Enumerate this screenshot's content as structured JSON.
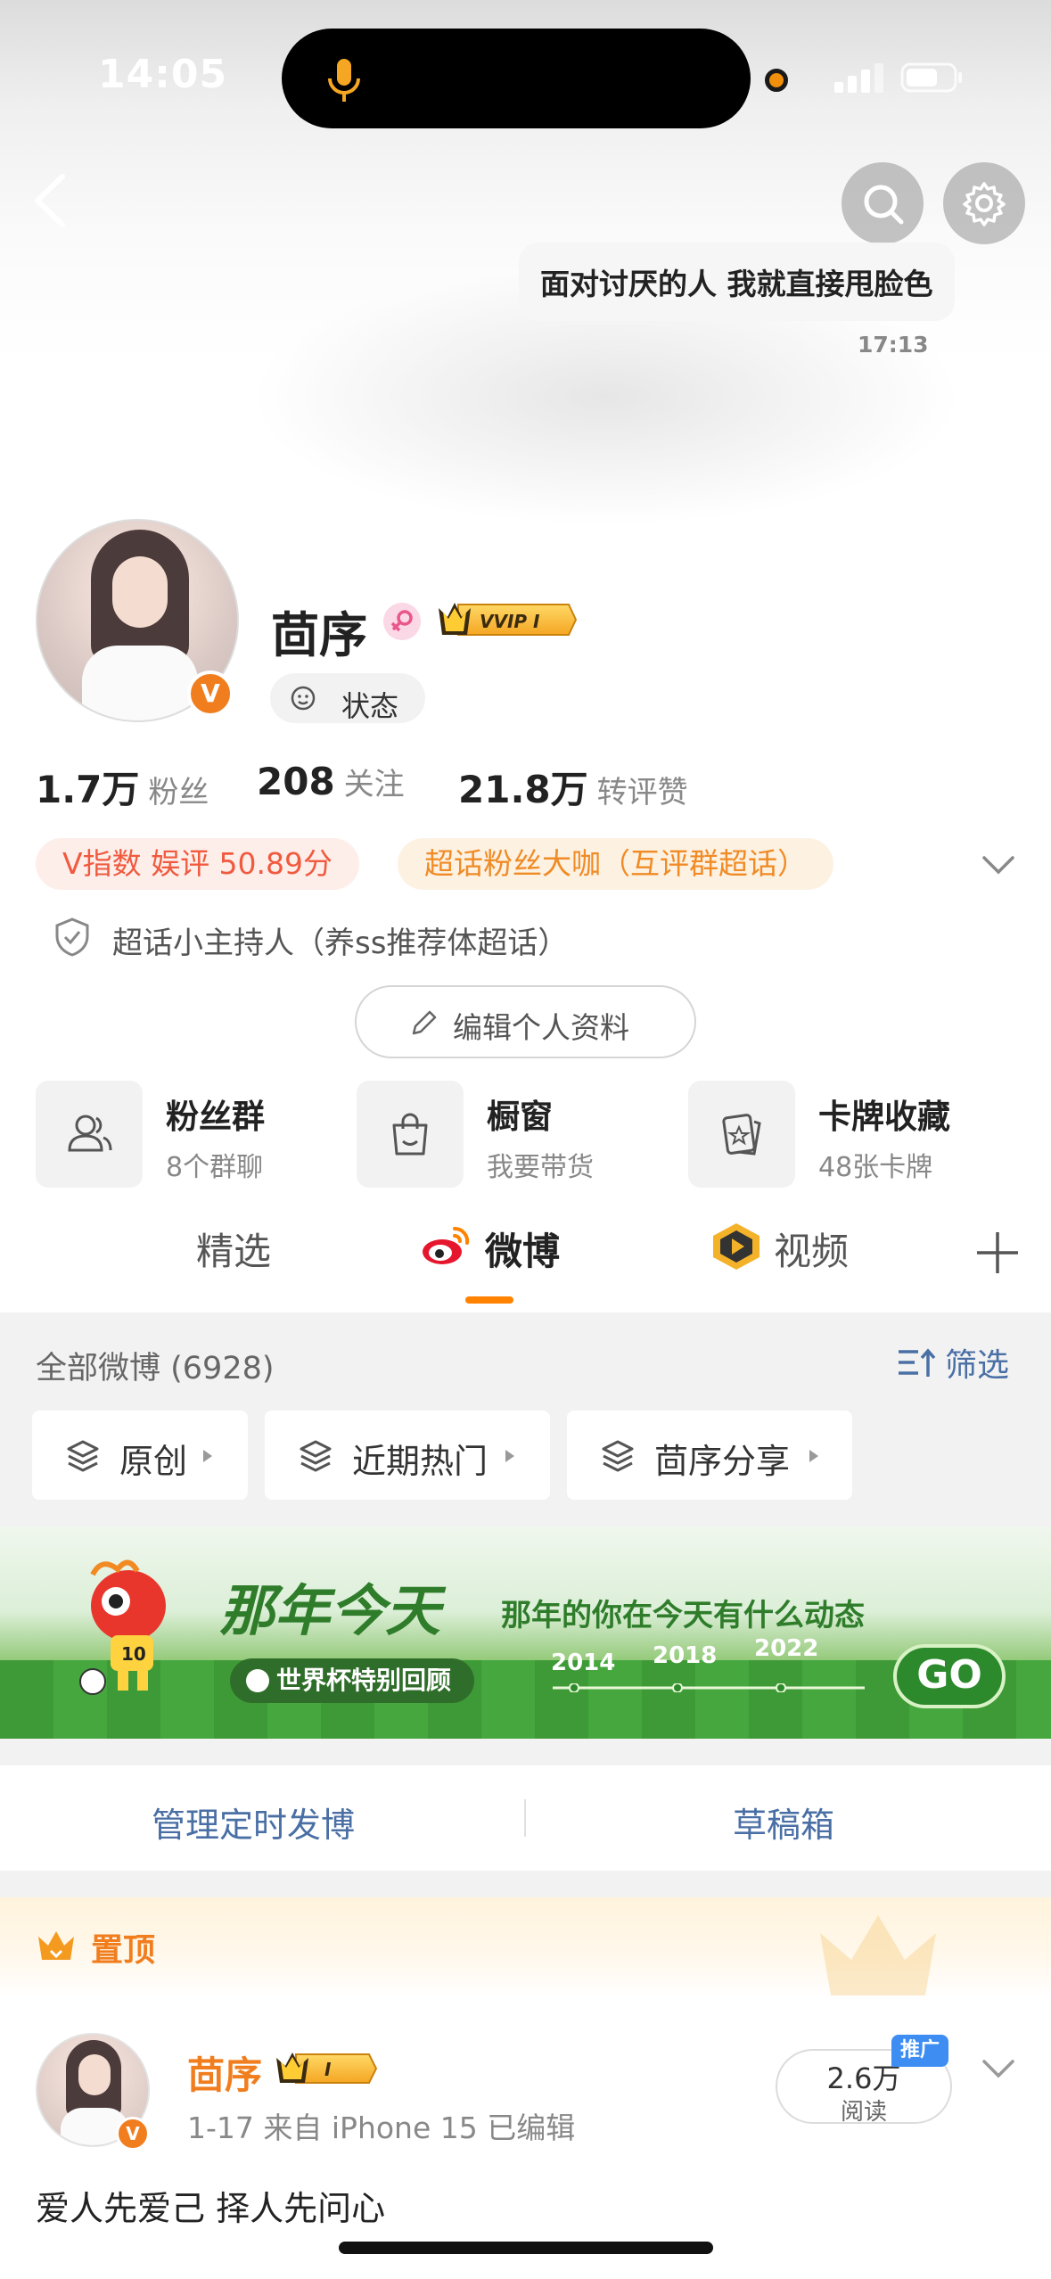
{
  "status_bar": {
    "time": "14:05"
  },
  "header": {
    "bubble_text": "面对讨厌的人 我就直接甩脸色",
    "bubble_time": "17:13"
  },
  "profile": {
    "name": "茴序",
    "vip_label": "VVIP I",
    "v_label": "V",
    "status_label": "状态",
    "stats": [
      {
        "value": "1.7万",
        "label": "粉丝"
      },
      {
        "value": "208",
        "label": "关注"
      },
      {
        "value": "21.8万",
        "label": "转评赞"
      }
    ],
    "tags": [
      "V指数 娱评 50.89分",
      "超话粉丝大咖（互评群超话）"
    ],
    "host_label": "超话小主持人（养ss推荐体超话）",
    "edit_label": "编辑个人资料",
    "features": [
      {
        "title": "粉丝群",
        "sub": "8个群聊",
        "icon": "fan-group-icon"
      },
      {
        "title": "橱窗",
        "sub": "我要带货",
        "icon": "shop-bag-icon"
      },
      {
        "title": "卡牌收藏",
        "sub": "48张卡牌",
        "icon": "card-collection-icon"
      }
    ]
  },
  "tabs": [
    {
      "label": "精选"
    },
    {
      "label": "微博",
      "active": true,
      "icon": "weibo-logo-icon"
    },
    {
      "label": "视频",
      "icon": "video-icon"
    }
  ],
  "feed": {
    "all_label": "全部微博 (6928)",
    "filter_label": "筛选",
    "chips": [
      "原创",
      "近期热门",
      "茴序分享"
    ],
    "banner": {
      "title": "那年今天",
      "subtitle": "那年的你在今天有什么动态",
      "pill": "世界杯特别回顾",
      "years": [
        "2014",
        "2018",
        "2022"
      ],
      "go": "GO",
      "jersey_number": "10"
    },
    "manage_scheduled": "管理定时发博",
    "drafts": "草稿箱"
  },
  "post": {
    "pinned_label": "置顶",
    "author": "茴序",
    "vip_label": "I",
    "meta": "1-17  来自 iPhone 15  已编辑",
    "reads_value": "2.6万",
    "reads_label": "阅读",
    "promo_label": "推广",
    "text": "爱人先爱己 择人先问心"
  },
  "colors": {
    "accent": "#ff8200",
    "link": "#4a6fa5",
    "orange": "#f07e1f"
  }
}
